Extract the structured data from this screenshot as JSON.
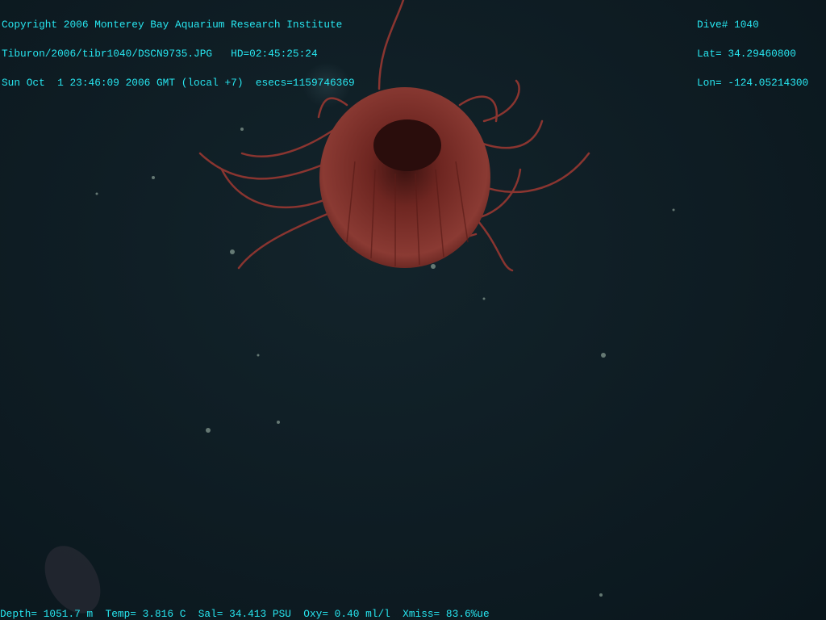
{
  "overlay": {
    "top_left": [
      "Copyright 2006 Monterey Bay Aquarium Research Institute",
      "Tiburon/2006/tibr1040/DSCN9735.JPG   HD=02:45:25:24",
      "Sun Oct  1 23:46:09 2006 GMT (local +7)  esecs=1159746369"
    ],
    "top_right": [
      "Dive# 1040",
      "Lat= 34.29460800",
      "Lon= -124.05214300"
    ],
    "bottom": "Depth= 1051.7 m  Temp= 3.816 C  Sal= 34.413 PSU  Oxy= 0.40 ml/l  Xmiss= 83.6%ue"
  },
  "colors": {
    "overlay_text": "#27e6f0",
    "water": "#0e1c23",
    "jelly_body": "#7a2a24"
  }
}
